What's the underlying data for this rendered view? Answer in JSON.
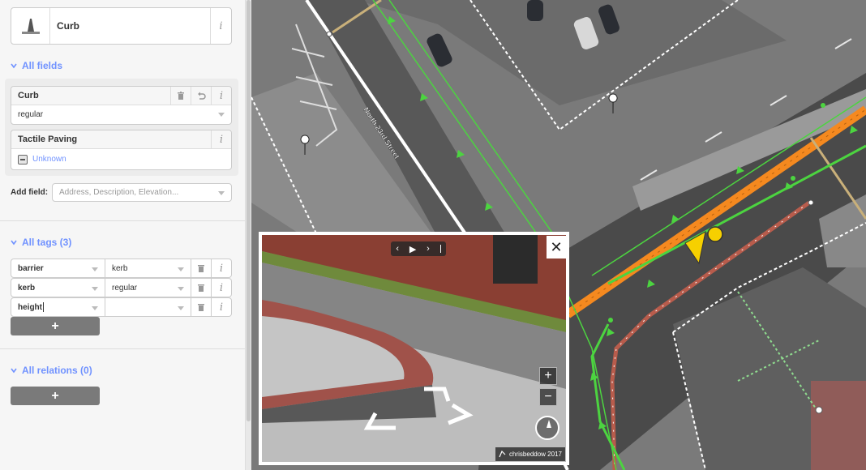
{
  "preset": {
    "label": "Curb",
    "icon": "curb-icon"
  },
  "sections": {
    "all_fields": "All fields",
    "all_tags": "All tags (3)",
    "all_relations": "All relations (0)"
  },
  "fields": {
    "curb": {
      "label": "Curb",
      "value": "regular"
    },
    "tactile": {
      "label": "Tactile Paving",
      "value": "Unknown"
    }
  },
  "add_field": {
    "label": "Add field:",
    "placeholder": "Address, Description, Elevation..."
  },
  "tags": [
    {
      "key": "barrier",
      "value": "kerb"
    },
    {
      "key": "kerb",
      "value": "regular"
    },
    {
      "key": "height",
      "value": ""
    }
  ],
  "add_button": "+",
  "map": {
    "street_label": "North 23rd Street"
  },
  "viewer": {
    "close": "✕",
    "nav_prev": "‹",
    "nav_play": "▶",
    "nav_next": "›",
    "zoom_in": "+",
    "zoom_out": "−",
    "attribution": "chrisbeddow 2017"
  },
  "colors": {
    "accent": "#7092ff",
    "selected": "#f6d000",
    "highway": "#f5891f",
    "footway": "#4cd440"
  }
}
